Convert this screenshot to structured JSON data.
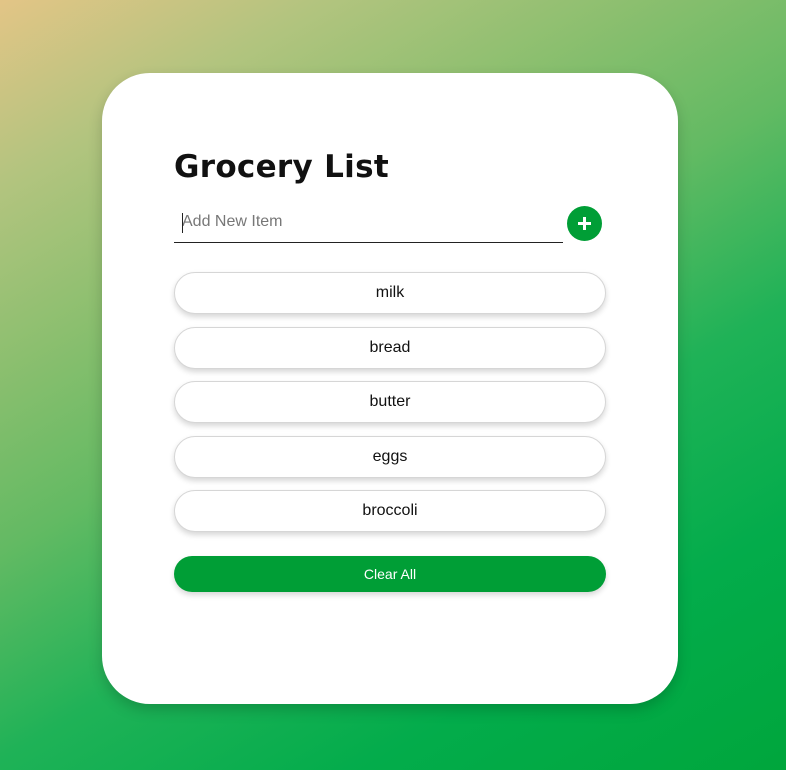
{
  "app": {
    "title": "Grocery List"
  },
  "new_item": {
    "placeholder": "Add New Item",
    "value": "",
    "add_icon": "plus-icon"
  },
  "items": [
    {
      "label": "milk"
    },
    {
      "label": "bread"
    },
    {
      "label": "butter"
    },
    {
      "label": "eggs"
    },
    {
      "label": "broccoli"
    }
  ],
  "actions": {
    "clear_all_label": "Clear All"
  },
  "colors": {
    "accent": "#009e36",
    "card": "#ffffff",
    "background_start": "#e3c586",
    "background_end": "#00a63c"
  }
}
